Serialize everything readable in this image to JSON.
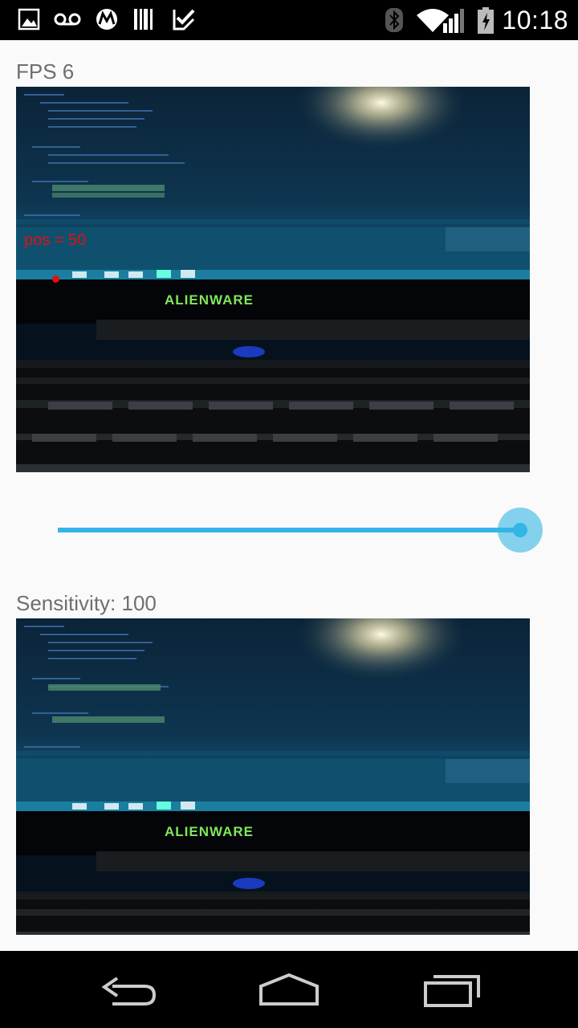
{
  "status_bar": {
    "time": "10:18",
    "icons": [
      "image-icon",
      "voicemail-icon",
      "motorola-icon",
      "barcode-icon",
      "checkbox-icon",
      "bluetooth-icon",
      "wifi-icon",
      "signal-icon",
      "battery-icon"
    ]
  },
  "main": {
    "fps_label": "FPS 6",
    "overlay_text": "pos = 50",
    "seekbar": {
      "value": 100,
      "max": 100
    },
    "sensitivity_label": "Sensitivity: 100",
    "camera_frame_text": "ALIENWARE"
  },
  "nav_bar": {
    "buttons": [
      "back-icon",
      "home-icon",
      "recents-icon"
    ]
  },
  "colors": {
    "accent": "#33b5e5",
    "overlay_red": "#e01010",
    "label_gray": "#6f6f6f"
  }
}
